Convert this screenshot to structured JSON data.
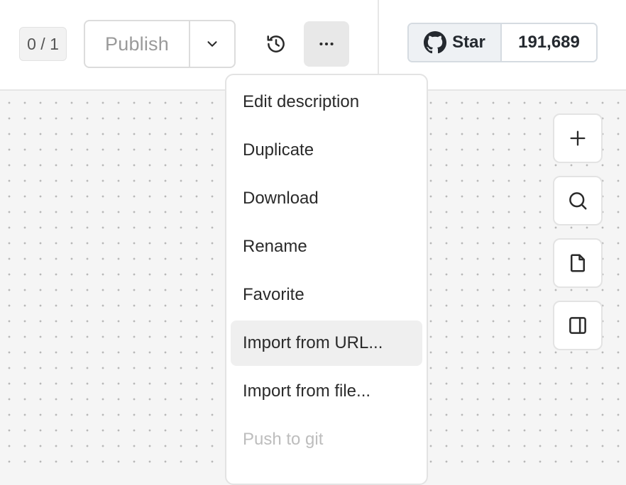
{
  "header": {
    "counter": "0 / 1",
    "publish_label": "Publish",
    "history_icon": "history-icon",
    "more_icon": "more-horizontal-icon",
    "github": {
      "star_label": "Star",
      "star_count": "191,689",
      "icon": "github-icon"
    }
  },
  "menu": {
    "items": [
      {
        "label": "Edit description",
        "state": "normal"
      },
      {
        "label": "Duplicate",
        "state": "normal"
      },
      {
        "label": "Download",
        "state": "normal"
      },
      {
        "label": "Rename",
        "state": "normal"
      },
      {
        "label": "Favorite",
        "state": "normal"
      },
      {
        "label": "Import from URL...",
        "state": "highlighted"
      },
      {
        "label": "Import from file...",
        "state": "normal"
      },
      {
        "label": "Push to git",
        "state": "disabled"
      }
    ]
  },
  "side_toolbar": {
    "icons": [
      "plus-icon",
      "search-icon",
      "file-icon",
      "panel-right-icon"
    ]
  },
  "colors": {
    "canvas_bg": "#f5f5f5",
    "menu_highlight": "#efefef",
    "disabled_text": "#bdbdbd"
  }
}
